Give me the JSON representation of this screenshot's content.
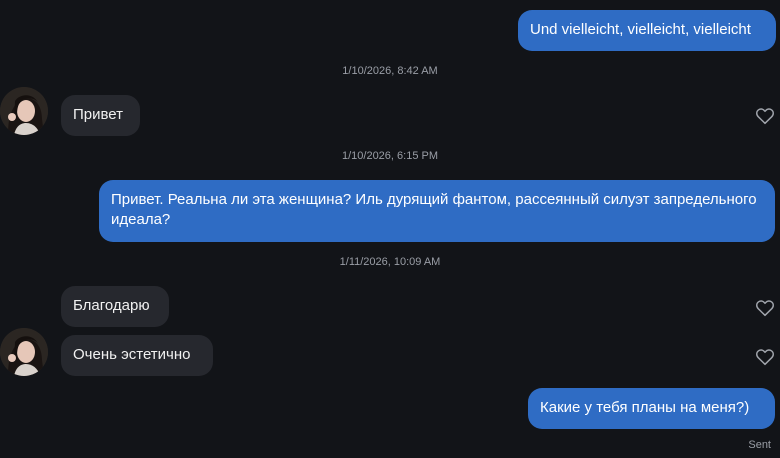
{
  "messages": {
    "m1": "Und vielleicht, vielleicht, vielleicht",
    "m2": "Привет",
    "m3": "Привет. Реальна ли эта женщина? Иль дурящий фантом, рассеянный силуэт запредельного идеала?",
    "m4": "Благодарю",
    "m5": "Очень эстетично",
    "m6": "Какие у тебя планы на меня?)"
  },
  "timestamps": {
    "t1": "1/10/2026, 8:42 AM",
    "t2": "1/10/2026, 6:15 PM",
    "t3": "1/11/2026, 10:09 AM"
  },
  "status": "Sent",
  "colors": {
    "background": "#121418",
    "outgoing_bubble": "#2f6cc4",
    "incoming_bubble": "#26282e",
    "meta_text": "#9a9ea6"
  },
  "icons": {
    "like": "heart-outline-icon",
    "avatar": "profile-photo"
  }
}
